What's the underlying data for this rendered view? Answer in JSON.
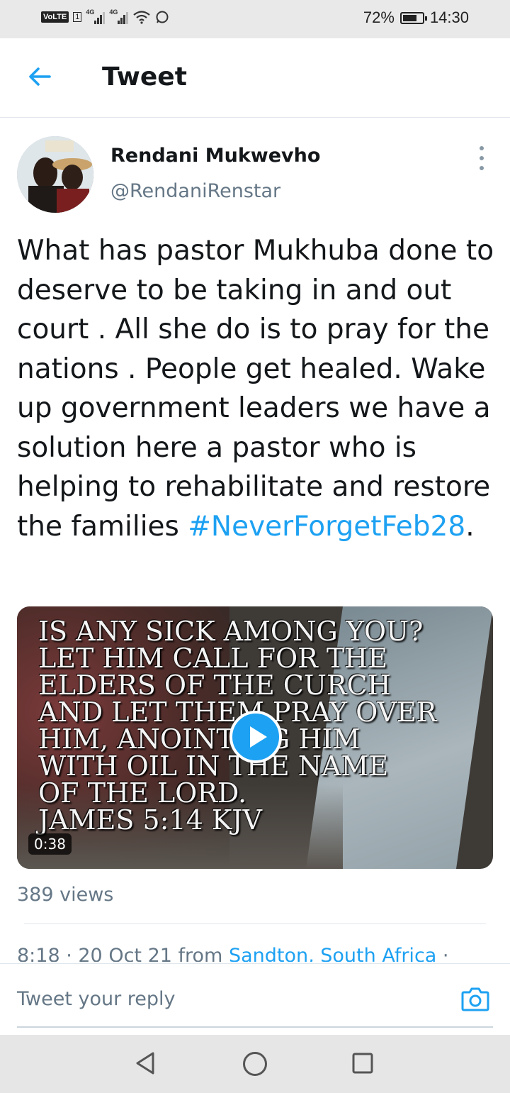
{
  "status_bar": {
    "volte": "VoLTE",
    "sim_number": "1",
    "network_1": "4G",
    "network_2": "4G",
    "battery_percent": "72%",
    "battery_level": 0.72,
    "time": "14:30"
  },
  "header": {
    "title": "Tweet",
    "back_icon": "arrow-left-icon"
  },
  "tweet": {
    "author_name": "Rendani Mukwevho",
    "author_handle": "@RendaniRenstar",
    "text_before": "What has pastor Mukhuba done to deserve to be taking in and out court . All she do is to pray for the nations . People get healed. Wake up government leaders we have a solution here a pastor who is helping to rehabilitate and restore the families ",
    "hashtag": "#NeverForgetFeb28",
    "text_after": ".",
    "video": {
      "overlay_lines": [
        "IS ANY SICK AMONG YOU?",
        "LET HIM CALL FOR THE",
        "ELDERS OF THE CURCH",
        "AND LET THEM PRAY OVER",
        "HIM, ANOINTING HIM",
        "WITH OIL IN THE NAME",
        "OF THE LORD.",
        "JAMES 5:14 KJV"
      ],
      "duration": "0:38"
    },
    "views": "389 views",
    "time": "8:18 · 20 Oct 21 from ",
    "location": "Sandton, South Africa",
    "meta_suffix": " ·"
  },
  "reply": {
    "placeholder": "Tweet your reply",
    "camera_icon": "camera-icon"
  },
  "colors": {
    "accent": "#1da1f2",
    "secondary_text": "#657786",
    "primary_text": "#14171a"
  }
}
